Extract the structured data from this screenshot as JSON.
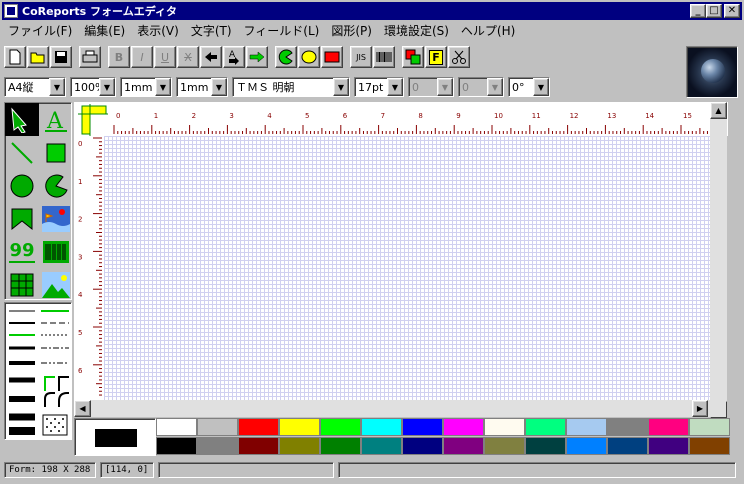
{
  "window": {
    "title": "CoReports フォームエディタ",
    "min": "_",
    "max": "□",
    "close": "✕"
  },
  "menu": [
    "ファイル(F)",
    "編集(E)",
    "表示(V)",
    "文字(T)",
    "フィールド(L)",
    "図形(P)",
    "環境設定(S)",
    "ヘルプ(H)"
  ],
  "toolbar": {
    "jis_label": "JIS",
    "bold": "B",
    "italic": "I",
    "underline": "U",
    "strike": "X",
    "font_label": "F"
  },
  "format": {
    "paper": "A4縦",
    "zoom": "100%",
    "grid1": "1mm",
    "grid2": "1mm",
    "font": "ＴＭＳ 明朝",
    "size": "17pt",
    "d1": "0",
    "d2": "0",
    "angle": "0°"
  },
  "ruler": {
    "h_labels": [
      "0",
      "1",
      "2",
      "3",
      "4",
      "5",
      "6",
      "7",
      "8",
      "9",
      "10",
      "11",
      "12",
      "13",
      "14",
      "15"
    ],
    "v_labels": [
      "0",
      "1",
      "2",
      "3",
      "4",
      "5",
      "6"
    ]
  },
  "tools": {
    "counter_label": "99"
  },
  "palette": {
    "selected": "#000000",
    "row1": [
      "#ffffff",
      "#c0c0c0",
      "#ff0000",
      "#ffff00",
      "#00ff00",
      "#00ffff",
      "#0000ff",
      "#ff00ff",
      "#fffbf0",
      "#00ff80",
      "#a6caf0",
      "#808080",
      "#ff0080",
      "#c0dcc0"
    ],
    "row2": [
      "#000000",
      "#808080",
      "#800000",
      "#808000",
      "#008000",
      "#008080",
      "#000080",
      "#800080",
      "#808040",
      "#004040",
      "#0080ff",
      "#004080",
      "#400080",
      "#804000"
    ]
  },
  "status": {
    "form_label": "Form:",
    "form_w": "198",
    "form_x": "X",
    "form_h": "288",
    "pos": "[114, 0]"
  }
}
